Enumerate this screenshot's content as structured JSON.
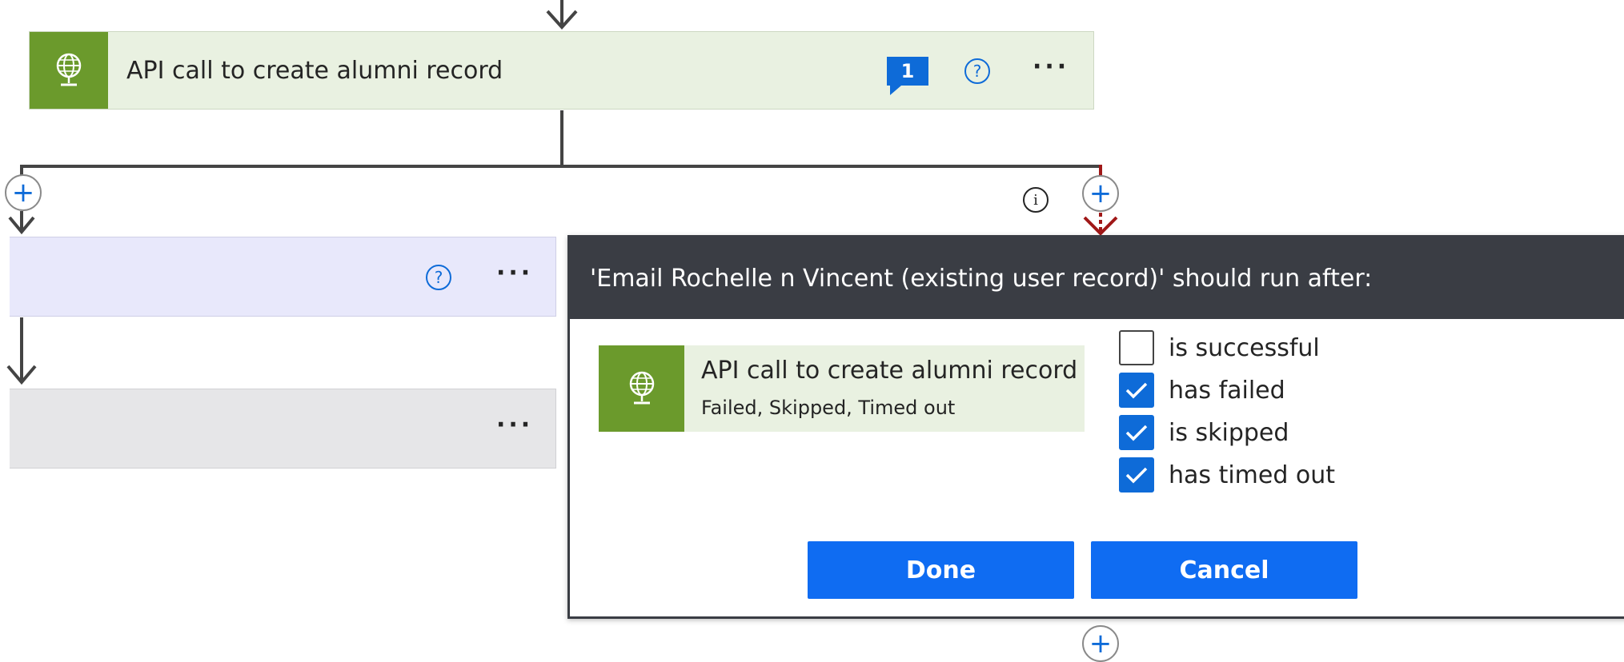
{
  "top_card": {
    "title": "API call to create alumni record",
    "comment_count": "1",
    "help_glyph": "?",
    "more_glyph": "···",
    "icon": "globe-network-icon",
    "accent_color": "#6b9a2c",
    "background_color": "#e9f1e1"
  },
  "branch": {
    "add_glyph": "+",
    "info_glyph": "i"
  },
  "left_cards": {
    "purple_help_glyph": "?",
    "purple_more_glyph": "···",
    "grey_more_glyph": "···"
  },
  "popup": {
    "header": "'Email Rochelle n Vincent (existing user record)' should run after:",
    "action": {
      "title": "API call to create alumni record",
      "status": "Failed, Skipped, Timed out",
      "icon": "globe-network-icon"
    },
    "options": [
      {
        "label": "is successful",
        "checked": false
      },
      {
        "label": "has failed",
        "checked": true
      },
      {
        "label": "is skipped",
        "checked": true
      },
      {
        "label": "has timed out",
        "checked": true
      }
    ],
    "done_label": "Done",
    "cancel_label": "Cancel",
    "button_color": "#0f6cf2",
    "header_color": "#3a3d44"
  }
}
